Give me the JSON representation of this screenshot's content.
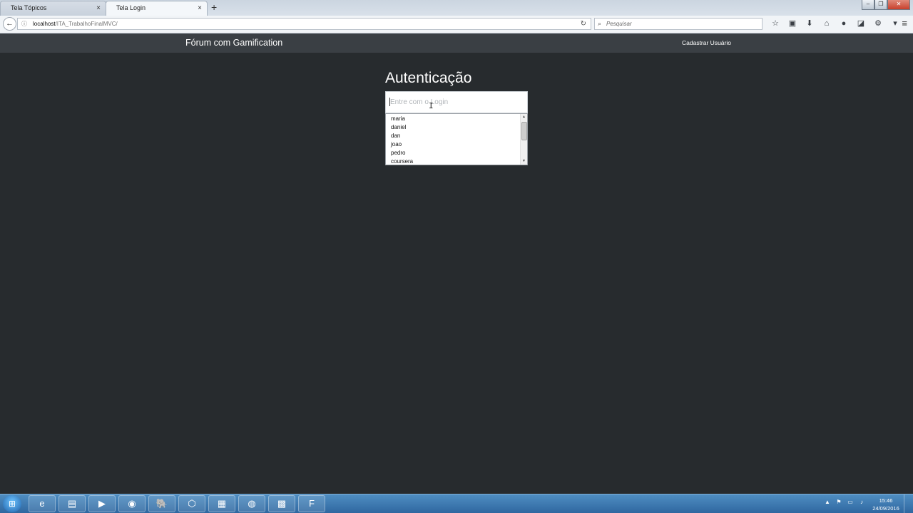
{
  "browser": {
    "tabs": [
      {
        "label": "Tela Tópicos",
        "active": false
      },
      {
        "label": "Tela Login",
        "active": true
      }
    ],
    "close_glyph": "×",
    "new_tab_glyph": "+",
    "url_host": "localhost",
    "url_path": "/ITA_TrabalhoFinalMVC/",
    "search_placeholder": "Pesquisar",
    "window_controls": [
      "–",
      "❐",
      "✕"
    ],
    "toolbar_icons": [
      "bookmark-star-icon",
      "library-icon",
      "download-icon",
      "home-icon",
      "chat-icon",
      "pocket-icon",
      "extension-icon",
      "dropdown-icon"
    ],
    "toolbar_glyphs": [
      "☆",
      "▣",
      "⬇",
      "⌂",
      "●",
      "◪",
      "⚙",
      "▾"
    ]
  },
  "navbar": {
    "brand": "Fórum com Gamification",
    "link": "Cadastrar Usuário"
  },
  "login": {
    "heading": "Autenticação",
    "placeholder": "Entre com o Login",
    "suggestions": [
      "maria",
      "daniel",
      "dan",
      "joao",
      "pedro",
      "coursera"
    ]
  },
  "taskbar": {
    "apps": [
      {
        "name": "internet-explorer-icon",
        "glyph": "e"
      },
      {
        "name": "file-explorer-icon",
        "glyph": "▤"
      },
      {
        "name": "media-player-icon",
        "glyph": "▶"
      },
      {
        "name": "chrome-icon",
        "glyph": "◉"
      },
      {
        "name": "postgresql-icon",
        "glyph": "🐘"
      },
      {
        "name": "virtualbox-icon",
        "glyph": "⬡"
      },
      {
        "name": "terminal-icon",
        "glyph": "▦"
      },
      {
        "name": "firefox-icon",
        "glyph": "◍"
      },
      {
        "name": "network-app-icon",
        "glyph": "▩"
      },
      {
        "name": "flow-app-icon",
        "glyph": "F"
      }
    ],
    "time": "15:46",
    "date": "24/09/2016"
  },
  "colors": {
    "page_bg": "#272b2e",
    "navbar_bg": "#3a3f44",
    "taskbar": "#3a78b3"
  }
}
